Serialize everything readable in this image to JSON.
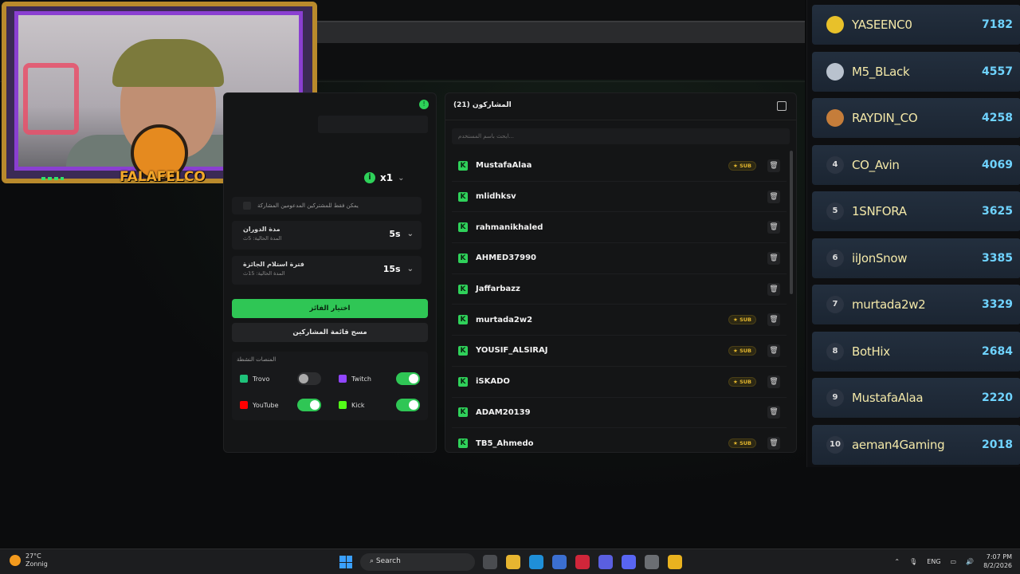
{
  "overlay": {
    "logo_text": "FALAFELCO"
  },
  "settings": {
    "multiplier": "x1",
    "only_subs_text": "يمكن فقط للمشتركين المدعومين المشاركة",
    "spin_duration": {
      "title": "مدة الدوران",
      "subtitle": "المدة الحالية: 5ث",
      "value": "5s"
    },
    "claim_period": {
      "title": "فترة استلام الجائزة",
      "subtitle": "المدة الحالية: 15ث",
      "value": "15s"
    },
    "pick_winner_label": "اختيار الفائز",
    "clear_list_label": "مسح قائمة المشاركين",
    "platforms_title": "المنصات النشطة",
    "platforms": [
      {
        "name": "Trovo",
        "enabled": false,
        "color": "#1fc27a"
      },
      {
        "name": "Twitch",
        "enabled": true,
        "color": "#9146ff"
      },
      {
        "name": "YouTube",
        "enabled": true,
        "color": "#ff0000"
      },
      {
        "name": "Kick",
        "enabled": true,
        "color": "#53fc18"
      }
    ]
  },
  "participants": {
    "title": "المشاركون (21)",
    "search_placeholder": "ابحث باسم المستخدم...",
    "sub_badge": "★ SUB",
    "rows": [
      {
        "name": "MustafaAlaa",
        "sub": true
      },
      {
        "name": "mlidhksv",
        "sub": false
      },
      {
        "name": "rahmanikhaled",
        "sub": false
      },
      {
        "name": "AHMED37990",
        "sub": false
      },
      {
        "name": "Jaffarbazz",
        "sub": false
      },
      {
        "name": "murtada2w2",
        "sub": true
      },
      {
        "name": "YOUSIF_ALSIRAJ",
        "sub": true
      },
      {
        "name": "iSKADO",
        "sub": true
      },
      {
        "name": "ADAM20139",
        "sub": false
      },
      {
        "name": "TB5_Ahmedo",
        "sub": true
      }
    ]
  },
  "leaderboard": [
    {
      "rank": "1",
      "name": "YASEENC0",
      "score": "7182",
      "medal": "gold"
    },
    {
      "rank": "2",
      "name": "M5_BLack",
      "score": "4557",
      "medal": "silver"
    },
    {
      "rank": "3",
      "name": "RAYDIN_CO",
      "score": "4258",
      "medal": "bronze"
    },
    {
      "rank": "4",
      "name": "CO_Avin",
      "score": "4069",
      "medal": ""
    },
    {
      "rank": "5",
      "name": "1SNFORA",
      "score": "3625",
      "medal": ""
    },
    {
      "rank": "6",
      "name": "iiJonSnow",
      "score": "3385",
      "medal": ""
    },
    {
      "rank": "7",
      "name": "murtada2w2",
      "score": "3329",
      "medal": ""
    },
    {
      "rank": "8",
      "name": "BotHix",
      "score": "2684",
      "medal": ""
    },
    {
      "rank": "9",
      "name": "MustafaAlaa",
      "score": "2220",
      "medal": ""
    },
    {
      "rank": "10",
      "name": "aeman4Gaming",
      "score": "2018",
      "medal": ""
    }
  ],
  "taskbar": {
    "temperature": "27°C",
    "weather": "Zonnig",
    "search_label": "Search",
    "language": "ENG",
    "time": "7:07 PM",
    "date": "8/2/2026"
  }
}
